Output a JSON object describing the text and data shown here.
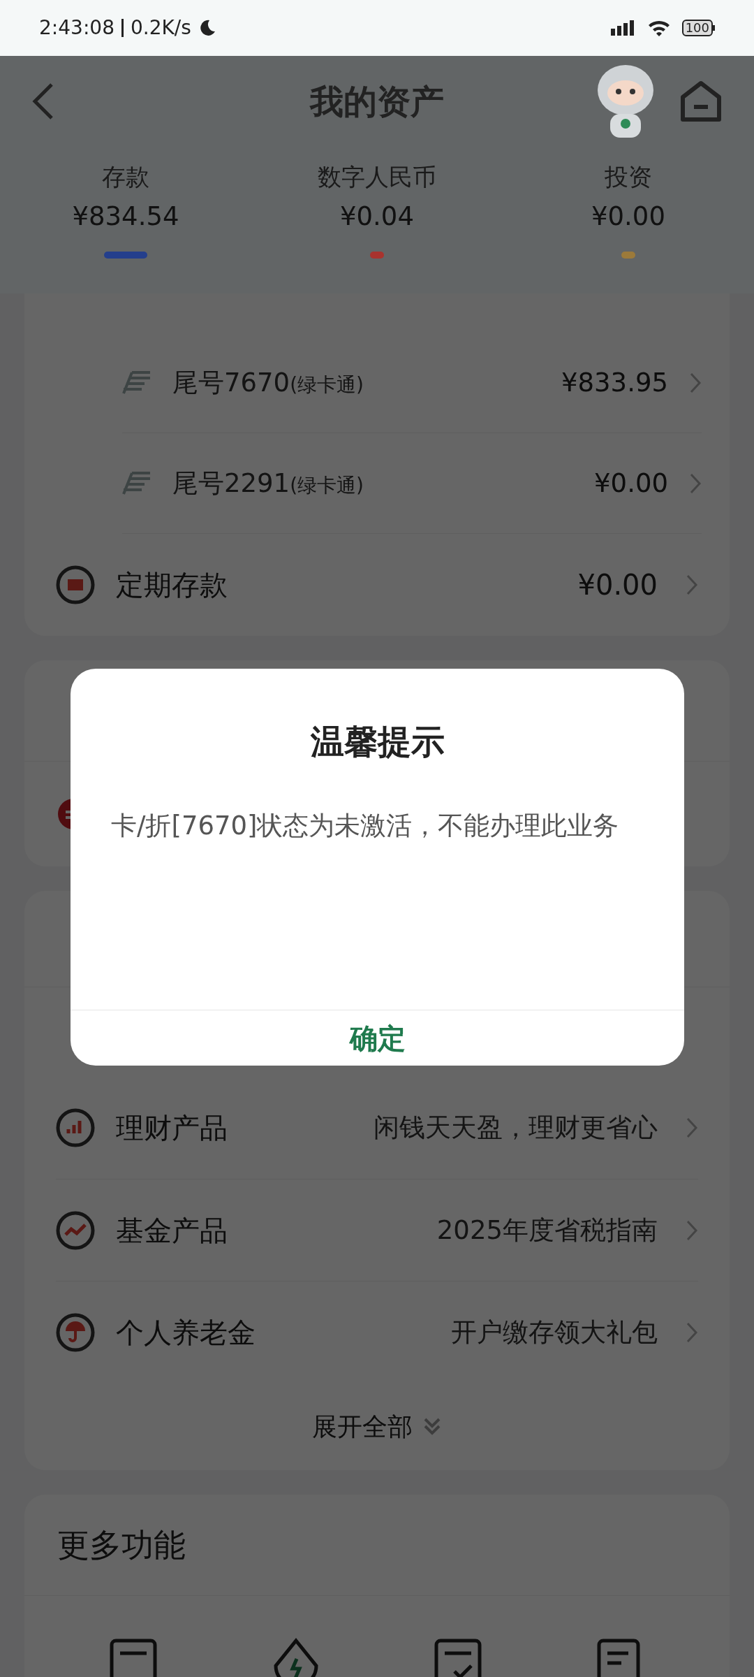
{
  "status_bar": {
    "time": "2:43:08",
    "speed": "0.2K/s",
    "battery": "100"
  },
  "header": {
    "title": "我的资产"
  },
  "tabs": [
    {
      "label": "存款",
      "amount": "¥834.54",
      "selected": true,
      "color": "#243f8c"
    },
    {
      "label": "数字人民币",
      "amount": "¥0.04",
      "selected": false,
      "color": "#a8332e"
    },
    {
      "label": "投资",
      "amount": "¥0.00",
      "selected": false,
      "color": "#9c7a3a"
    }
  ],
  "deposit_card": {
    "sub_accounts": [
      {
        "name": "尾号7670",
        "tag": "(绿卡通)",
        "amount": "¥833.95"
      },
      {
        "name": "尾号2291",
        "tag": "(绿卡通)",
        "amount": "¥0.00"
      }
    ],
    "time_deposit": {
      "label": "定期存款",
      "amount": "¥0.00"
    }
  },
  "invest_card": {
    "products": [
      {
        "label": "理财产品",
        "note": "闲钱天天盈，理财更省心"
      },
      {
        "label": "基金产品",
        "note": "2025年度省税指南"
      },
      {
        "label": "个人养老金",
        "note": "开户缴存领大礼包"
      }
    ],
    "expand": "展开全部"
  },
  "more_card": {
    "title": "更多功能"
  },
  "dialog": {
    "title": "温馨提示",
    "message": "卡/折[7670]状态为未激活，不能办理此业务",
    "button": "确定"
  }
}
